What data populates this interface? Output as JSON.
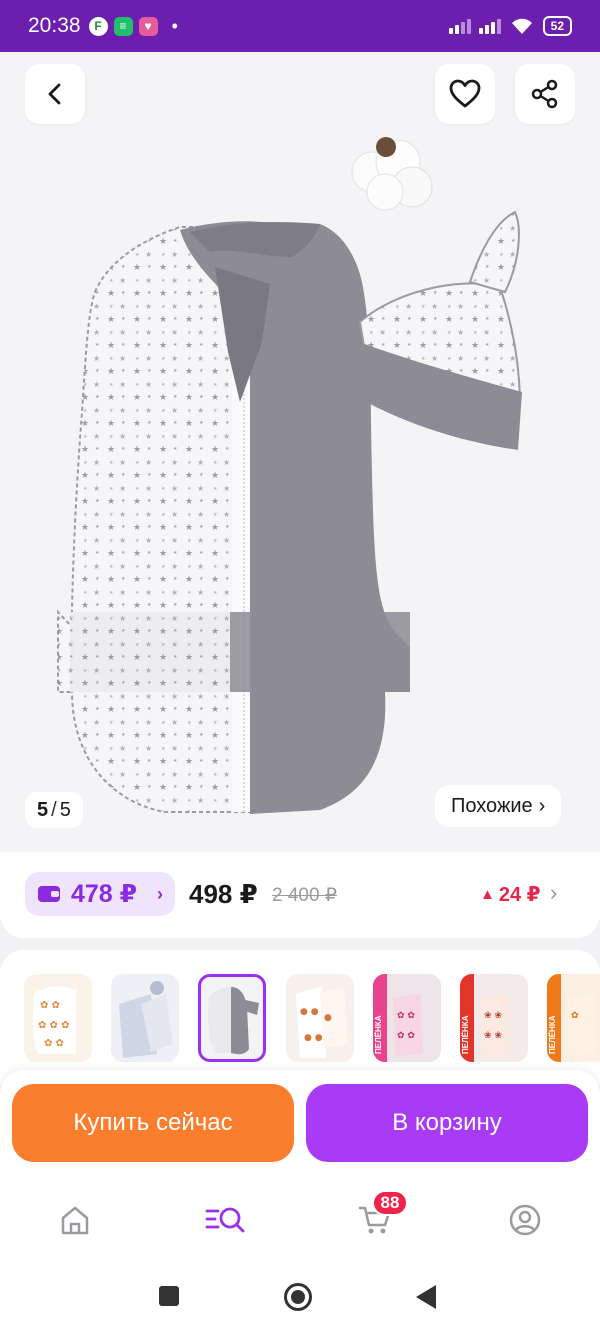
{
  "status_bar": {
    "time": "20:38",
    "battery": "52",
    "dot": "•"
  },
  "gallery": {
    "current": "5",
    "separator": "/",
    "total": "5",
    "similar_label": "Похожие",
    "similar_chevron": "›"
  },
  "price": {
    "wallet_price": "478 ₽",
    "wallet_chevron": "›",
    "price": "498 ₽",
    "old_price": "2 400 ₽",
    "points": "24 ₽",
    "points_arrow": "▲",
    "chevron": "›"
  },
  "actions": {
    "buy_now": "Купить сейчас",
    "add_to_cart": "В корзину"
  },
  "nav": {
    "cart_badge": "88"
  },
  "thumbnails": {
    "active_index": 2,
    "labels": [
      "",
      "",
      "",
      "",
      "ПЕЛЁНКА",
      "ПЕЛЁНКА",
      "ПЕЛЁНКА"
    ]
  },
  "colors": {
    "brand_purple": "#6c1fae",
    "buy_orange": "#fb7d2e",
    "cart_purple": "#a93af5",
    "accent_red": "#e8264b"
  }
}
